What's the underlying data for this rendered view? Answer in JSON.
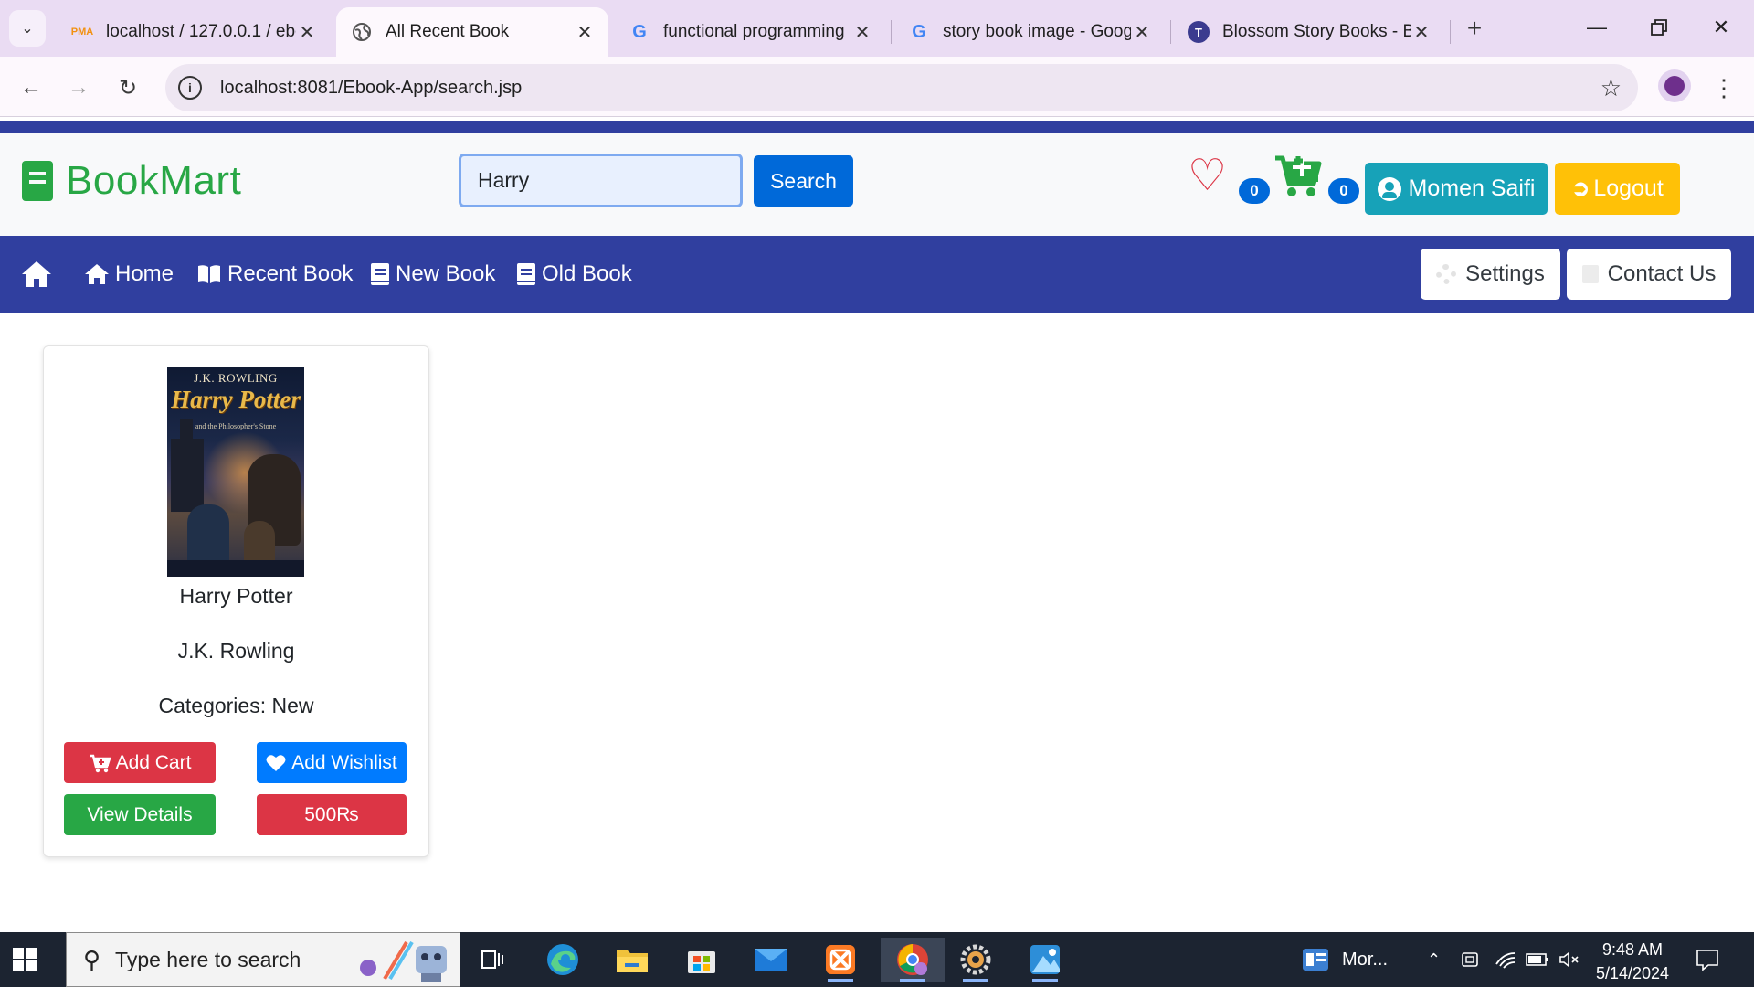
{
  "browser": {
    "tabs": [
      {
        "title": "localhost / 127.0.0.1 / ebo",
        "favicon": "PMA",
        "active": false
      },
      {
        "title": "All Recent Book",
        "favicon": "globe-icon",
        "active": true
      },
      {
        "title": "functional programming",
        "favicon": "G",
        "active": false
      },
      {
        "title": "story book image - Goog",
        "favicon": "G",
        "active": false
      },
      {
        "title": "Blossom Story Books - B",
        "favicon": "T",
        "active": false
      }
    ],
    "url": "localhost:8081/Ebook-App/search.jsp"
  },
  "header": {
    "brand": "BookMart",
    "search_value": "Harry",
    "search_button": "Search",
    "wishlist_count": "0",
    "cart_count": "0",
    "user_name": "Momen Saifi",
    "logout_label": "Logout"
  },
  "nav": {
    "items": [
      "Home",
      "Recent Book",
      "New Book",
      "Old Book"
    ],
    "settings_label": "Settings",
    "contact_label": "Contact Us"
  },
  "books": [
    {
      "cover_author": "J.K. ROWLING",
      "cover_title": "Harry Potter",
      "cover_subtitle": "and the Philosopher's Stone",
      "title": "Harry Potter",
      "author": "J.K. Rowling",
      "category": "Categories: New",
      "add_cart": "Add Cart",
      "add_wishlist": "Add Wishlist",
      "view_details": "View Details",
      "price": "500₨"
    }
  ],
  "taskbar": {
    "search_placeholder": "Type here to search",
    "widget_label": "Mor...",
    "time": "9:48 AM",
    "date": "5/14/2024"
  },
  "colors": {
    "primary_nav": "#303f9f",
    "brand_green": "#28a745",
    "danger": "#dc3545",
    "primary": "#007bff",
    "info": "#17a2b8",
    "warning": "#ffc107"
  }
}
